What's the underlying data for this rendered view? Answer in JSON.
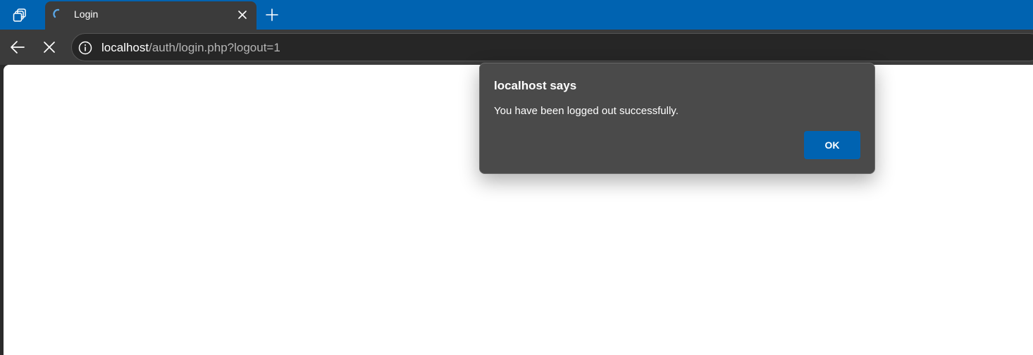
{
  "browser": {
    "workspaces_icon": "workspaces-icon",
    "tab": {
      "title": "Login",
      "favicon": "loading-spinner-icon",
      "close_icon": "close-icon"
    },
    "new_tab_icon": "plus-icon",
    "toolbar": {
      "back_icon": "back-arrow-icon",
      "stop_icon": "stop-loading-icon",
      "site_info_icon": "info-icon",
      "url_host": "localhost",
      "url_path": "/auth/login.php?logout=1"
    }
  },
  "dialog": {
    "title": "localhost says",
    "message": "You have been logged out successfully.",
    "ok_label": "OK"
  },
  "colors": {
    "accent": "#0063b1",
    "tab_bg": "#3b3b3b",
    "dialog_bg": "#4a4a4a",
    "page_bg": "#ffffff"
  }
}
